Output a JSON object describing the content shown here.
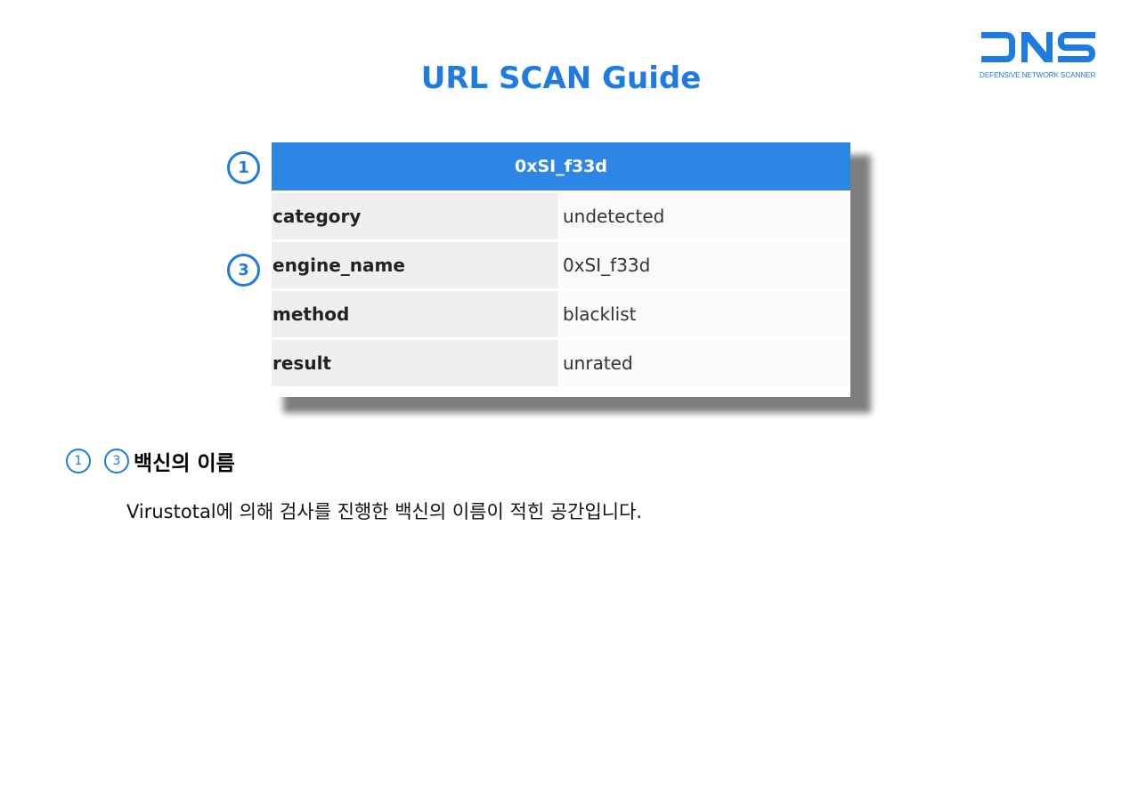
{
  "page": {
    "title": "URL SCAN Guide"
  },
  "logo": {
    "wordmark": "DNS",
    "tagline": "DEFENSIVE NETWORK SCANNER",
    "color": "#1e7be0"
  },
  "table": {
    "header": "0xSI_f33d",
    "rows": [
      {
        "key": "category",
        "value": "undetected"
      },
      {
        "key": "engine_name",
        "value": "0xSI_f33d"
      },
      {
        "key": "method",
        "value": "blacklist"
      },
      {
        "key": "result",
        "value": "unrated"
      }
    ],
    "header_color": "#2d86e3"
  },
  "markers": {
    "one": "1",
    "three": "3"
  },
  "section": {
    "title": "백신의 이름",
    "description": "Virustotal에 의해 검사를 진행한 백신의 이름이 적힌 공간입니다."
  }
}
